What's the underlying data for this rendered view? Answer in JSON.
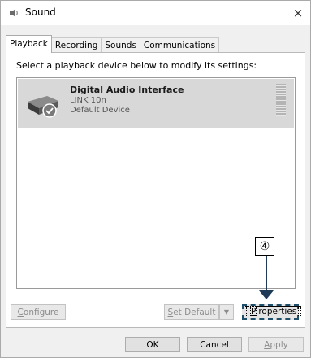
{
  "window": {
    "title": "Sound",
    "close_glyph": "×"
  },
  "tabs": [
    {
      "label": "Playback",
      "active": true
    },
    {
      "label": "Recording",
      "active": false
    },
    {
      "label": "Sounds",
      "active": false
    },
    {
      "label": "Communications",
      "active": false
    }
  ],
  "instruction": "Select a playback device below to modify its settings:",
  "devices": [
    {
      "name": "Digital Audio Interface",
      "model": "LINK 10n",
      "status": "Default Device",
      "icon": "speaker-device-icon",
      "selected": true
    }
  ],
  "callout": {
    "label": "④"
  },
  "buttons": {
    "configure": {
      "pre": "",
      "ul": "C",
      "post": "onfigure",
      "enabled": false
    },
    "set_default": {
      "pre": "",
      "ul": "S",
      "post": "et Default",
      "enabled": false
    },
    "dropdown_glyph": "▼",
    "properties": {
      "pre": "",
      "ul": "P",
      "post": "roperties",
      "enabled": true
    },
    "ok": "OK",
    "cancel": "Cancel",
    "apply": {
      "pre": "",
      "ul": "A",
      "post": "pply",
      "enabled": false
    }
  },
  "colors": {
    "arrow": "#1f3a56",
    "selection": "#d8d8d8"
  }
}
